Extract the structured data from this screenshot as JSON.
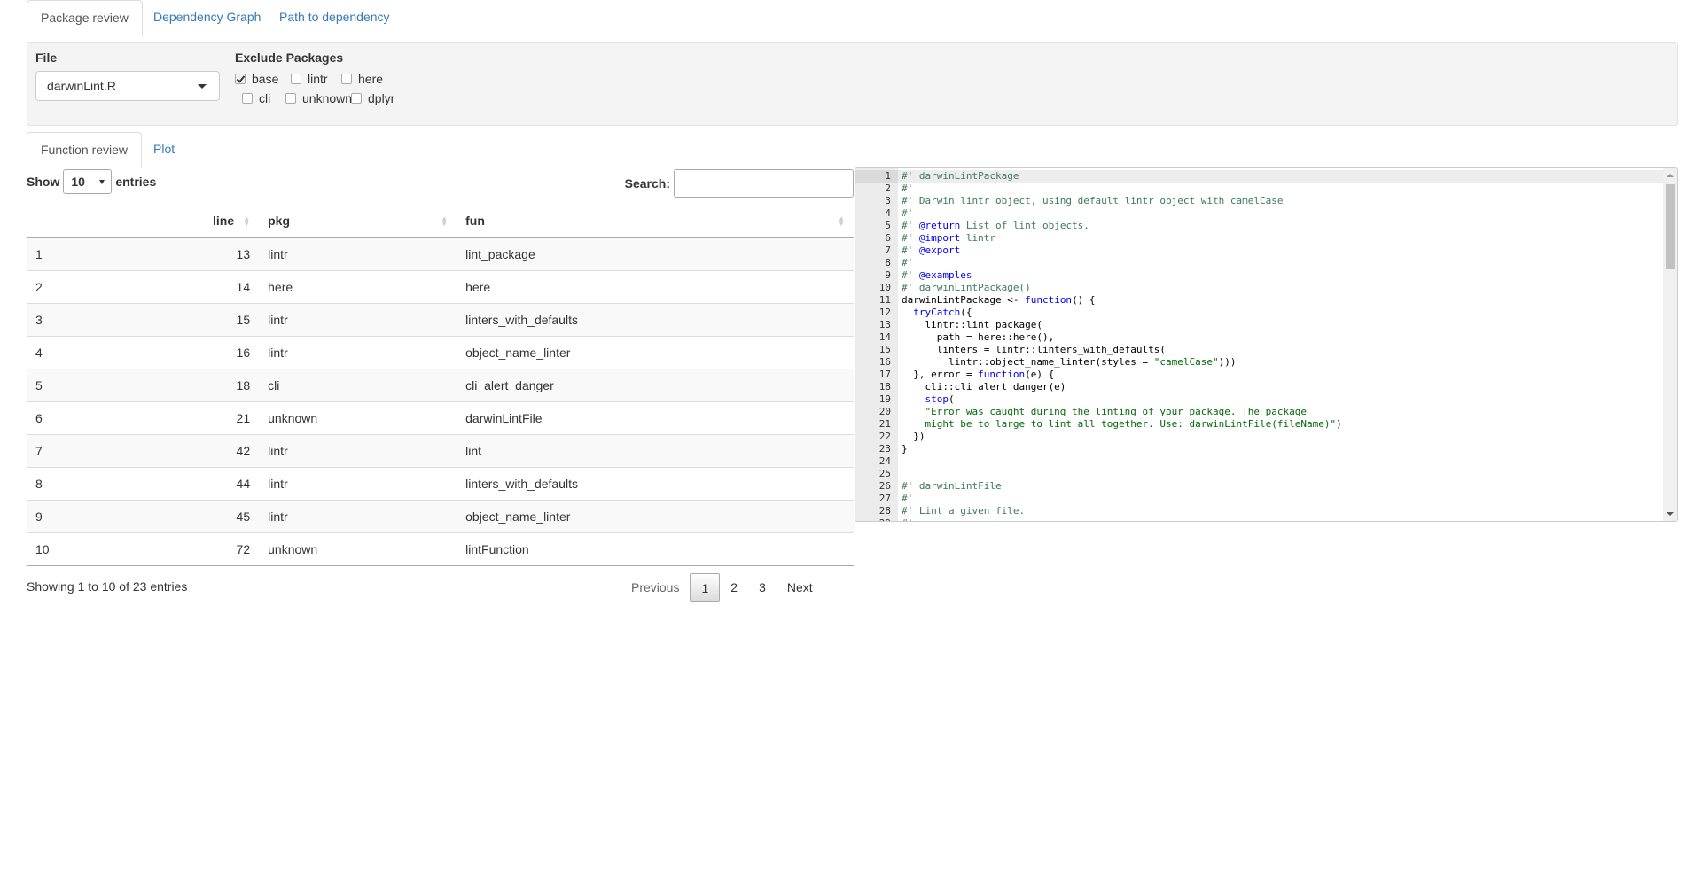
{
  "tabs": [
    {
      "label": "Package review",
      "active": true
    },
    {
      "label": "Dependency Graph",
      "active": false
    },
    {
      "label": "Path to dependency",
      "active": false
    }
  ],
  "controls": {
    "file_label": "File",
    "file_value": "darwinLint.R",
    "exclude_label": "Exclude Packages",
    "packages": [
      {
        "name": "base",
        "checked": true
      },
      {
        "name": "lintr",
        "checked": false
      },
      {
        "name": "here",
        "checked": false
      },
      {
        "name": "cli",
        "checked": false
      },
      {
        "name": "unknown",
        "checked": false
      },
      {
        "name": "dplyr",
        "checked": false
      }
    ]
  },
  "subtabs": [
    {
      "label": "Function review",
      "active": true
    },
    {
      "label": "Plot",
      "active": false
    }
  ],
  "datatable": {
    "show_label": "Show",
    "length_value": "10",
    "entries_label": "entries",
    "search_label": "Search:",
    "search_value": "",
    "columns": [
      "",
      "line",
      "pkg",
      "fun"
    ],
    "rows": [
      [
        "1",
        "13",
        "lintr",
        "lint_package"
      ],
      [
        "2",
        "14",
        "here",
        "here"
      ],
      [
        "3",
        "15",
        "lintr",
        "linters_with_defaults"
      ],
      [
        "4",
        "16",
        "lintr",
        "object_name_linter"
      ],
      [
        "5",
        "18",
        "cli",
        "cli_alert_danger"
      ],
      [
        "6",
        "21",
        "unknown",
        "darwinLintFile"
      ],
      [
        "7",
        "42",
        "lintr",
        "lint"
      ],
      [
        "8",
        "44",
        "lintr",
        "linters_with_defaults"
      ],
      [
        "9",
        "45",
        "lintr",
        "object_name_linter"
      ],
      [
        "10",
        "72",
        "unknown",
        "lintFunction"
      ]
    ],
    "info": "Showing 1 to 10 of 23 entries",
    "pagination": {
      "previous": "Previous",
      "pages": [
        "1",
        "2",
        "3"
      ],
      "current": "1",
      "next": "Next"
    }
  },
  "code": {
    "lines": [
      [
        [
          "doc",
          "#' darwinLintPackage"
        ]
      ],
      [
        [
          "doc",
          "#'"
        ]
      ],
      [
        [
          "doc",
          "#' Darwin lintr object, using default lintr object with camelCase"
        ]
      ],
      [
        [
          "doc",
          "#'"
        ]
      ],
      [
        [
          "doc",
          "#' "
        ],
        [
          "tag",
          "@return"
        ],
        [
          "doc",
          " List of lint objects."
        ]
      ],
      [
        [
          "doc",
          "#' "
        ],
        [
          "tag",
          "@import"
        ],
        [
          "doc",
          " lintr"
        ]
      ],
      [
        [
          "doc",
          "#' "
        ],
        [
          "tag",
          "@export"
        ]
      ],
      [
        [
          "doc",
          "#'"
        ]
      ],
      [
        [
          "doc",
          "#' "
        ],
        [
          "tag",
          "@examples"
        ]
      ],
      [
        [
          "doc",
          "#' darwinLintPackage()"
        ]
      ],
      [
        [
          "plain",
          "darwinLintPackage <- "
        ],
        [
          "kw",
          "function"
        ],
        [
          "plain",
          "() {"
        ]
      ],
      [
        [
          "plain",
          "  "
        ],
        [
          "kw",
          "tryCatch"
        ],
        [
          "plain",
          "({"
        ]
      ],
      [
        [
          "plain",
          "    lintr::lint_package("
        ]
      ],
      [
        [
          "plain",
          "      path = here::here(),"
        ]
      ],
      [
        [
          "plain",
          "      linters = lintr::linters_with_defaults("
        ]
      ],
      [
        [
          "plain",
          "        lintr::object_name_linter(styles = "
        ],
        [
          "str",
          "\"camelCase\""
        ],
        [
          "plain",
          ")))"
        ]
      ],
      [
        [
          "plain",
          "  }, error = "
        ],
        [
          "kw",
          "function"
        ],
        [
          "plain",
          "(e) {"
        ]
      ],
      [
        [
          "plain",
          "    cli::cli_alert_danger(e)"
        ]
      ],
      [
        [
          "plain",
          "    "
        ],
        [
          "kw",
          "stop"
        ],
        [
          "plain",
          "("
        ]
      ],
      [
        [
          "str",
          "    \"Error was caught during the linting of your package. The package"
        ]
      ],
      [
        [
          "str",
          "    might be to large to lint all together. Use: darwinLintFile(fileName)\""
        ],
        [
          "plain",
          ")"
        ]
      ],
      [
        [
          "plain",
          "  })"
        ]
      ],
      [
        [
          "plain",
          "}"
        ]
      ],
      [
        [
          "plain",
          ""
        ]
      ],
      [
        [
          "plain",
          ""
        ]
      ],
      [
        [
          "doc",
          "#' darwinLintFile"
        ]
      ],
      [
        [
          "doc",
          "#'"
        ]
      ],
      [
        [
          "doc",
          "#' Lint a given file."
        ]
      ],
      [
        [
          "doc",
          "#'"
        ]
      ]
    ]
  }
}
